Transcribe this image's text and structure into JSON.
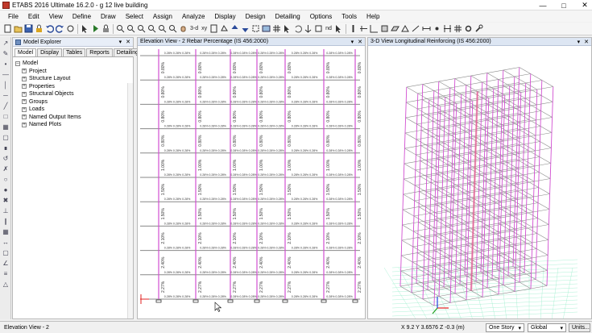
{
  "window": {
    "title": "ETABS 2016 Ultimate 16.2.0 - g 12 live building"
  },
  "menu": [
    "File",
    "Edit",
    "View",
    "Define",
    "Draw",
    "Select",
    "Assign",
    "Analyze",
    "Display",
    "Design",
    "Detailing",
    "Options",
    "Tools",
    "Help"
  ],
  "toolbar": {
    "view3d_label": "3-d",
    "xy_label": "xy",
    "nd_label": "nd"
  },
  "model_explorer": {
    "title": "Model Explorer",
    "tabs": [
      "Model",
      "Display",
      "Tables",
      "Reports",
      "Detailing"
    ],
    "active_tab": "Model",
    "root": "Model",
    "items": [
      "Project",
      "Structure Layout",
      "Properties",
      "Structural Objects",
      "Groups",
      "Loads",
      "Named Output Items",
      "Named Plots"
    ]
  },
  "elevation_view": {
    "title": "Elevation View - 2  Rebar Percentage  (IS 456:2000)",
    "column_values": [
      "0.80%",
      "0.80%",
      "0.80%",
      "1.00%",
      "1.50%",
      "2.10%",
      "2.40%",
      "2.27%"
    ],
    "beam_label": "0.28% 0.28% 0.28%"
  },
  "view_3d": {
    "title": "3-D View  Longitudinal Reinforcing  (IS 456:2000)"
  },
  "status": {
    "view_name": "Elevation View - 2",
    "coords": "X 9.2  Y 3.6576  Z -0.3 (m)",
    "story": "One Story",
    "coord_system": "Global",
    "units_button": "Units..."
  },
  "colors": {
    "frame_pink": "#d14fd1",
    "frame_grey": "#888888",
    "axis_red": "#e02020",
    "axis_green": "#20a020",
    "axis_blue": "#2040e0"
  }
}
